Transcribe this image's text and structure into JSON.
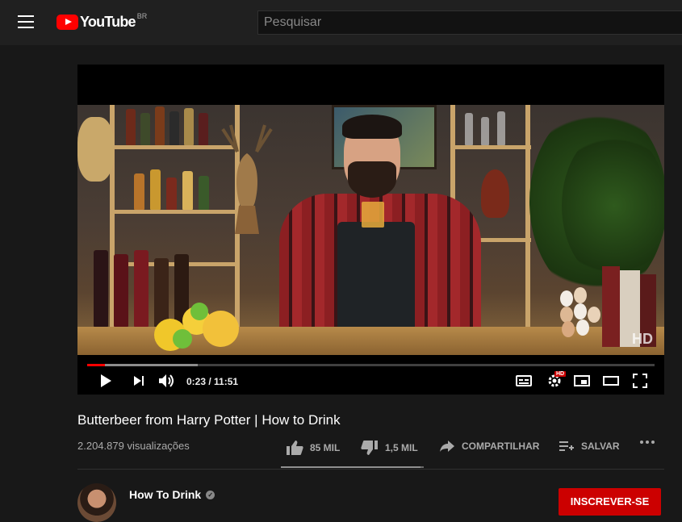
{
  "header": {
    "logo_text": "YouTube",
    "logo_region": "BR",
    "search_placeholder": "Pesquisar"
  },
  "player": {
    "current_time": "0:23",
    "duration": "11:51",
    "time_display": "0:23 / 11:51",
    "progress_played": 0.032,
    "progress_loaded": 0.195,
    "quality_badge": "HD",
    "watermark": "HD"
  },
  "video": {
    "title": "Butterbeer from Harry Potter | How to Drink",
    "views": "2.204.879 visualizações",
    "likes": "85 MIL",
    "dislikes": "1,5 MIL",
    "share_label": "COMPARTILHAR",
    "save_label": "SALVAR",
    "like_ratio": 0.98
  },
  "channel": {
    "name": "How To Drink",
    "subscribe_label": "INSCREVER-SE"
  },
  "colors": {
    "accent": "#ff0000",
    "background": "#181818",
    "header": "#202020",
    "subscribe": "#cc0000"
  },
  "icons": [
    "menu-icon",
    "youtube-logo-icon",
    "play-icon",
    "next-icon",
    "volume-icon",
    "subtitles-icon",
    "settings-icon",
    "miniplayer-icon",
    "theater-icon",
    "fullscreen-icon",
    "thumbs-up-icon",
    "thumbs-down-icon",
    "share-icon",
    "add-to-playlist-icon",
    "more-icon",
    "verified-icon"
  ]
}
